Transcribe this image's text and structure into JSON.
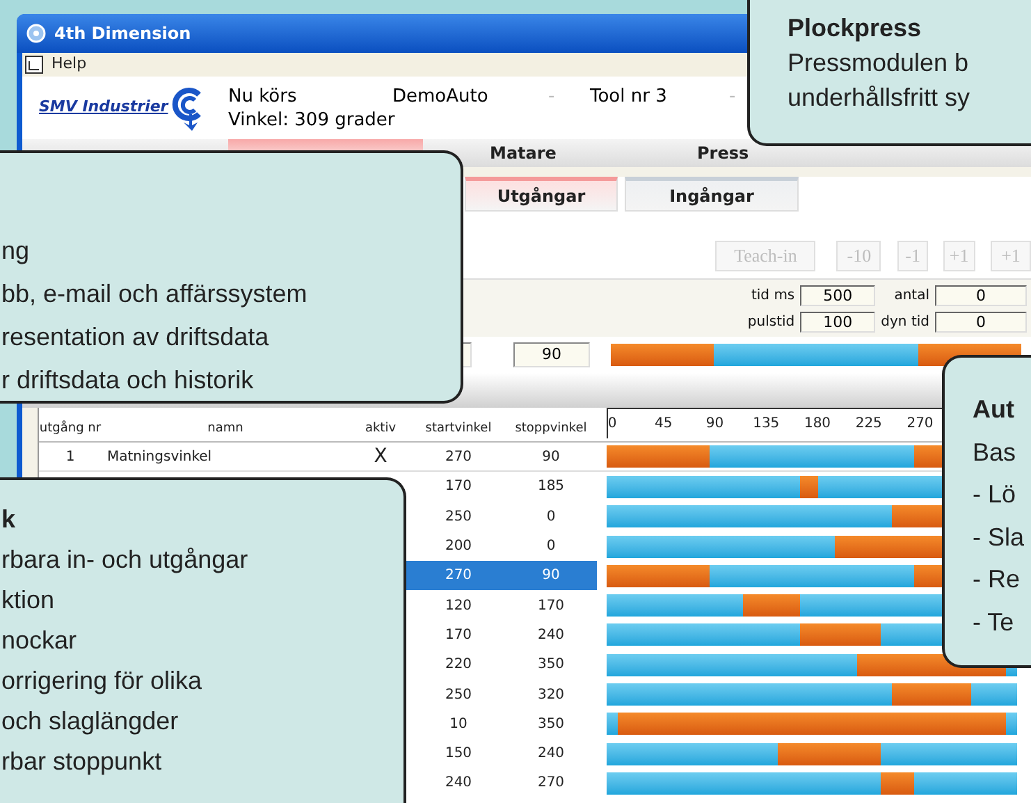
{
  "window": {
    "title": "4th Dimension"
  },
  "menu": [
    "Help"
  ],
  "header": {
    "logo": "SMV Industrier",
    "status_label": "Nu körs",
    "program": "DemoAuto",
    "separator_1": "-",
    "tool": "Tool nr 3",
    "separator_2": "-",
    "angle": "Vinkel: 309 grader"
  },
  "tabs": [
    {
      "label": "Matare",
      "selected": false
    },
    {
      "label": "Press",
      "selected": false
    }
  ],
  "subtabs": [
    {
      "label": "Utgångar",
      "selected": true
    },
    {
      "label": "Ingångar",
      "selected": false
    }
  ],
  "toolbar_buttons": [
    {
      "label": "Teach-in",
      "disabled": true
    },
    {
      "label": "-10",
      "disabled": true
    },
    {
      "label": "-1",
      "disabled": true
    },
    {
      "label": "+1",
      "disabled": true
    },
    {
      "label": "+1",
      "disabled": true
    }
  ],
  "timing": [
    {
      "label": "tid ms",
      "value": "500"
    },
    {
      "label": "antal",
      "value": "0"
    },
    {
      "label": "pulstid",
      "value": "100"
    },
    {
      "label": "dyn tid",
      "value": "0"
    }
  ],
  "edit_row": {
    "stop": "90"
  },
  "table": {
    "columns": [
      "utgång nr",
      "namn",
      "aktiv",
      "startvinkel",
      "stoppvinkel"
    ],
    "axis_ticks": [
      "0",
      "45",
      "90",
      "135",
      "180",
      "225",
      "270"
    ],
    "rows": [
      {
        "number": "1",
        "name": "Matningsvinkel",
        "active": "X",
        "start": "270",
        "stop": "90",
        "selected": false
      },
      {
        "start": "170",
        "stop": "185",
        "selected": false
      },
      {
        "start": "250",
        "stop": "0",
        "selected": false
      },
      {
        "start": "200",
        "stop": "0",
        "selected": false
      },
      {
        "start": "270",
        "stop": "90",
        "selected": true
      },
      {
        "start": "120",
        "stop": "170",
        "selected": false
      },
      {
        "start": "170",
        "stop": "240",
        "selected": false
      },
      {
        "start": "220",
        "stop": "350",
        "selected": false
      },
      {
        "start": "250",
        "stop": "320",
        "selected": false
      },
      {
        "start": "10",
        "stop": "350",
        "selected": false
      },
      {
        "start": "150",
        "stop": "240",
        "selected": false
      },
      {
        "start": "240",
        "stop": "270",
        "selected": false
      }
    ]
  },
  "callouts": [
    {
      "title": "Plockpress",
      "lines": [
        "Pressmodulen b",
        "underhållsfritt sy"
      ]
    },
    {
      "lines": [
        "ng",
        "bb, e-mail och affärssystem",
        "resentation av driftsdata",
        "r driftsdata och historik"
      ]
    },
    {
      "title": "k",
      "lines": [
        "rbara in- och utgångar",
        "ktion",
        "nockar",
        "orrigering för olika",
        "och slaglängder",
        "rbar stoppunkt"
      ]
    },
    {
      "title": "Aut",
      "lines": [
        "Bas",
        "- Lö",
        "- Sla",
        "- Re",
        "- Te"
      ]
    }
  ]
}
